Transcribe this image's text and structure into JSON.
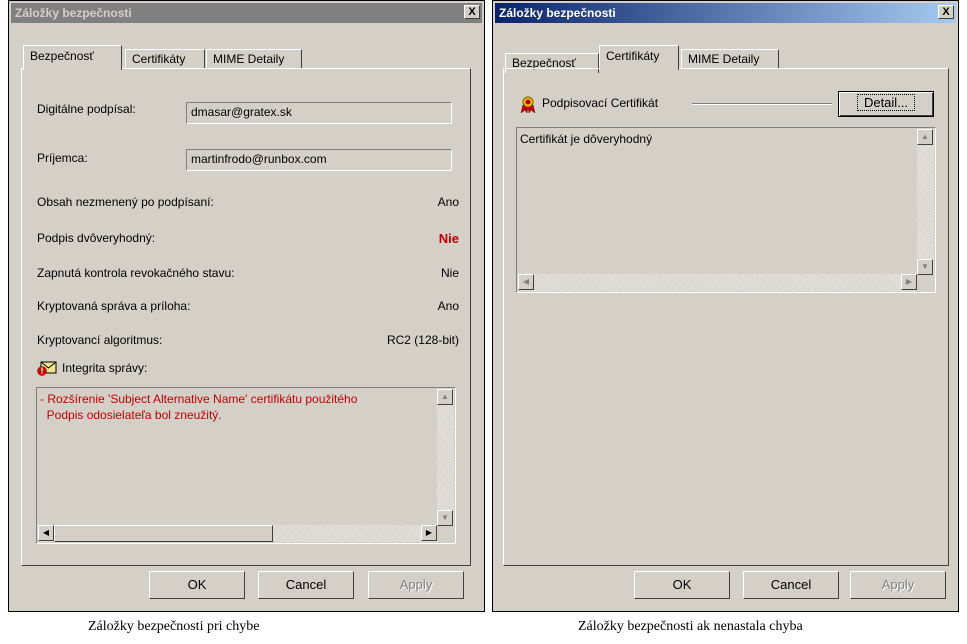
{
  "left": {
    "title": "Záložky bezpečnosti",
    "close": "X",
    "tabs": [
      "Bezpečnosť",
      "Certifikáty",
      "MIME Detaily"
    ],
    "signed_by_label": "Digitálne podpísal:",
    "signed_by_value": "dmasar@gratex.sk",
    "recipient_label": "Príjemca:",
    "recipient_value": "martinfrodo@runbox.com",
    "rows": [
      {
        "label": "Obsah nezmenený po podpísaní:",
        "value": "Ano"
      },
      {
        "label": "Podpis dvôveryhodný:",
        "value": "Nie"
      },
      {
        "label": "Zapnutá kontrola revokačného stavu:",
        "value": "Nie"
      },
      {
        "label": "Kryptovaná správa a príloha:",
        "value": "Ano"
      },
      {
        "label": "Kryptovancí algoritmus:",
        "value": "RC2 (128-bit)"
      }
    ],
    "integrity_label": "Integrita správy:",
    "integrity_text": "- Rozšírenie 'Subject Alternative Name' certifikátu použitého\n  Podpis odosielateľa bol zneužitý.",
    "buttons": {
      "ok": "OK",
      "cancel": "Cancel",
      "apply": "Apply"
    },
    "caption": "Záložky bezpečnosti pri chybe"
  },
  "right": {
    "title": "Záložky bezpečnosti",
    "close": "X",
    "tabs": [
      "Bezpečnosť",
      "Certifikáty",
      "MIME Detaily"
    ],
    "cert_label": "Podpisovací Certifikát",
    "detail_button": "Detail...",
    "cert_text": "Certifikát je dôveryhodný",
    "buttons": {
      "ok": "OK",
      "cancel": "Cancel",
      "apply": "Apply"
    },
    "caption": "Záložky bezpečnosti ak nenastala chyba"
  },
  "colors": {
    "error_red": "#c00000",
    "active_title": "#0a246a",
    "inactive_title": "#808080"
  }
}
